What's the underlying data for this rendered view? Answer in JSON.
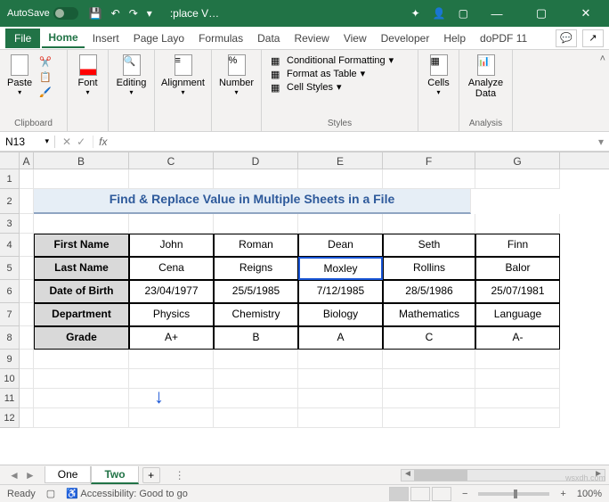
{
  "titlebar": {
    "autosave_label": "AutoSave",
    "doc_title": ":place V…",
    "icons": {
      "save": "💾",
      "undo": "↶",
      "redo": "↷",
      "dropdown": "▾",
      "bling": "✦",
      "user": "👤",
      "box": "▢",
      "minimize": "—",
      "restore": "▢",
      "close": "✕"
    }
  },
  "tabs": {
    "file": "File",
    "home": "Home",
    "insert": "Insert",
    "pagelayout": "Page Layo",
    "formulas": "Formulas",
    "data": "Data",
    "review": "Review",
    "view": "View",
    "developer": "Developer",
    "help": "Help",
    "dopdf": "doPDF 11"
  },
  "ribbon": {
    "clipboard": {
      "paste": "Paste",
      "label": "Clipboard"
    },
    "font": {
      "btn": "Font",
      "label": ""
    },
    "editing": {
      "btn": "Editing",
      "label": ""
    },
    "alignment": {
      "btn": "Alignment",
      "label": ""
    },
    "number": {
      "btn": "Number",
      "label": ""
    },
    "styles": {
      "cond": "Conditional Formatting",
      "fat": "Format as Table",
      "cs": "Cell Styles",
      "label": "Styles"
    },
    "cells": {
      "btn": "Cells",
      "label": ""
    },
    "analysis": {
      "btn": "Analyze Data",
      "label": "Analysis"
    }
  },
  "formula_row": {
    "name_box": "N13",
    "fx": "fx"
  },
  "grid": {
    "columns": [
      "A",
      "B",
      "C",
      "D",
      "E",
      "F",
      "G"
    ],
    "title": "Find & Replace Value in Multiple Sheets in a File",
    "labels": {
      "first": "First Name",
      "last": "Last Name",
      "dob": "Date of Birth",
      "dept": "Department",
      "grade": "Grade"
    },
    "first": [
      "John",
      "Roman",
      "Dean",
      "Seth",
      "Finn"
    ],
    "last": [
      "Cena",
      "Reigns",
      "Moxley",
      "Rollins",
      "Balor"
    ],
    "dob": [
      "23/04/1977",
      "25/5/1985",
      "7/12/1985",
      "28/5/1986",
      "25/07/1981"
    ],
    "dept": [
      "Physics",
      "Chemistry",
      "Biology",
      "Mathematics",
      "Language"
    ],
    "grade": [
      "A+",
      "B",
      "A",
      "C",
      "A-"
    ]
  },
  "sheets": {
    "one": "One",
    "two": "Two",
    "add": "+"
  },
  "status": {
    "ready": "Ready",
    "acc": "Accessibility: Good to go",
    "zoom": "100%"
  },
  "watermark": "wsxdh.com"
}
